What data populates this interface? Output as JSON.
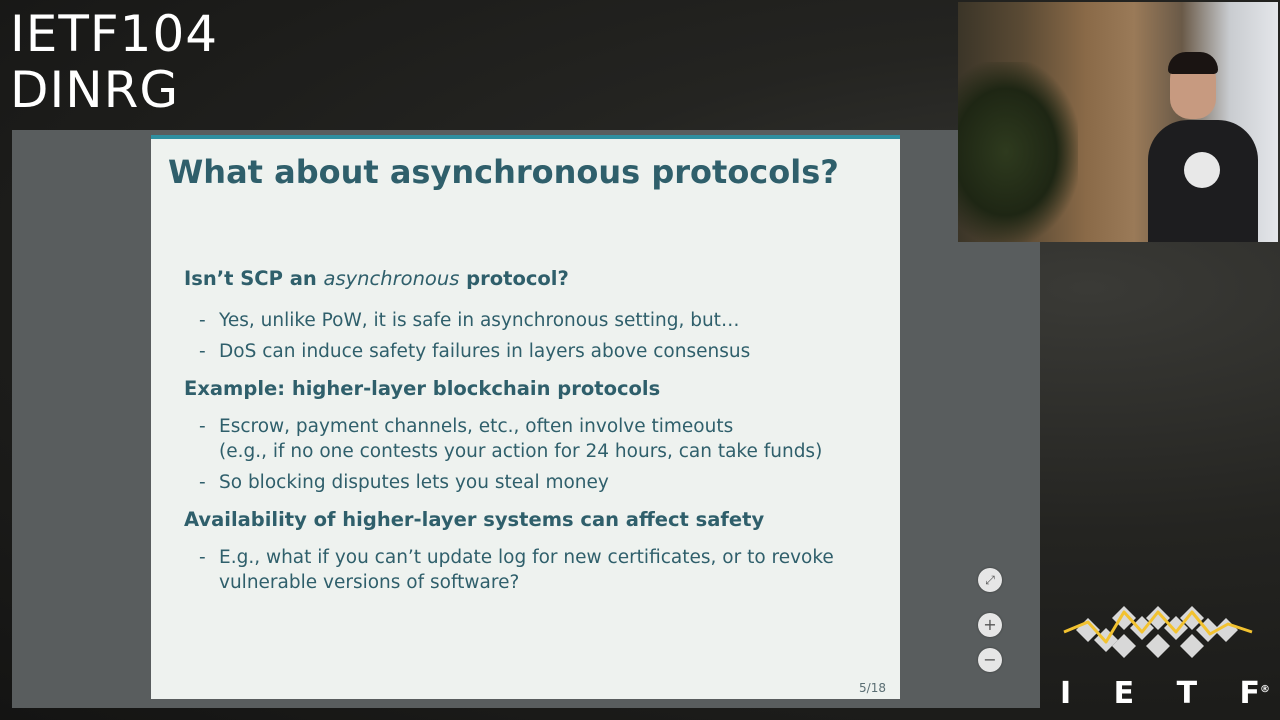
{
  "overlay": {
    "event_line1": "IETF104",
    "event_line2": "DINRG"
  },
  "slide": {
    "title": "What about asynchronous protocols?",
    "sections": [
      {
        "heading_pre": "Isn’t SCP an ",
        "heading_em": "asynchronous",
        "heading_post": " protocol?",
        "bullets": [
          {
            "lines": [
              "Yes, unlike PoW, it is safe in asynchronous setting, but…"
            ]
          },
          {
            "lines": [
              "DoS can induce safety failures in layers above consensus"
            ]
          }
        ]
      },
      {
        "heading": "Example: higher-layer blockchain protocols",
        "bullets": [
          {
            "lines": [
              "Escrow, payment channels, etc., often involve timeouts",
              "(e.g., if no one contests your action for 24 hours, can take funds)"
            ]
          },
          {
            "lines": [
              "So blocking disputes lets you steal money"
            ]
          }
        ]
      },
      {
        "heading": "Availability of higher-layer systems can affect safety",
        "bullets": [
          {
            "lines": [
              "E.g., what if you can’t update log for new certificates, or to revoke",
              "vulnerable versions of software?"
            ]
          }
        ]
      }
    ],
    "page_number": "5/18",
    "bullet_marker": "-"
  },
  "controls": {
    "fullscreen_icon": "fullscreen-icon",
    "zoom_in_label": "+",
    "zoom_out_label": "−",
    "fullscreen_label": "⤢"
  },
  "logo": {
    "wordmark": [
      "I",
      "E",
      "T",
      "F"
    ],
    "registered": "®"
  },
  "colors": {
    "slide_accent": "#2f8fa0",
    "slide_text": "#2f5f6b",
    "logo_yellow": "#f2c230",
    "logo_diamond": "#d8d8d8"
  }
}
